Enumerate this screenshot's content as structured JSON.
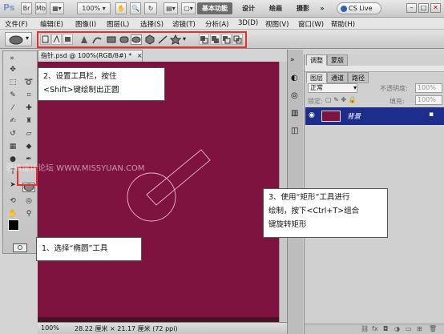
{
  "app": {
    "logo": "Ps",
    "toolbar_zoom": "100%",
    "workspaces": [
      "基本功能",
      "设计",
      "绘画",
      "摄影"
    ],
    "cs_live": "CS Live",
    "window_buttons": [
      "–",
      "□",
      "✕"
    ]
  },
  "menu": [
    "文件(F)",
    "编辑(E)",
    "图像(I)",
    "图层(L)",
    "选择(S)",
    "滤镜(T)",
    "分析(A)",
    "3D(D)",
    "视图(V)",
    "窗口(W)",
    "帮助(H)"
  ],
  "document": {
    "tab_title": "指针.psd @ 100%(RGB/8#) *",
    "tab_close": "×",
    "status_zoom": "100%",
    "status_info": "28.22 厘米 × 21.17 厘米 (72 ppi)",
    "canvas_color": "#7f1340"
  },
  "panel": {
    "tabs": [
      "调整",
      "蒙版"
    ],
    "sub_tabs": [
      "图层",
      "通道",
      "路径"
    ],
    "blend_mode": "正常",
    "opacity_label": "不透明度:",
    "opacity_value": "100%",
    "lock_label": "锁定:",
    "fill_label": "填充:",
    "fill_value": "100%",
    "layer_name": "背景",
    "layer_color": "#1d2d8a"
  },
  "callouts": {
    "step1": "1、选择“椭圆”工具",
    "step2_line1": "2、设置工具栏，按住",
    "step2_line2": "<Shift>键绘制出正圆",
    "step3_line1": "3、使用“矩形”工具进行",
    "step3_line2": "绘制，按下<Ctrl+T>组合",
    "step3_line3": "键旋转矩形"
  },
  "watermark": "思缘设计论坛 WWW.MISSYUAN.COM",
  "accent_color": "#e4312e"
}
